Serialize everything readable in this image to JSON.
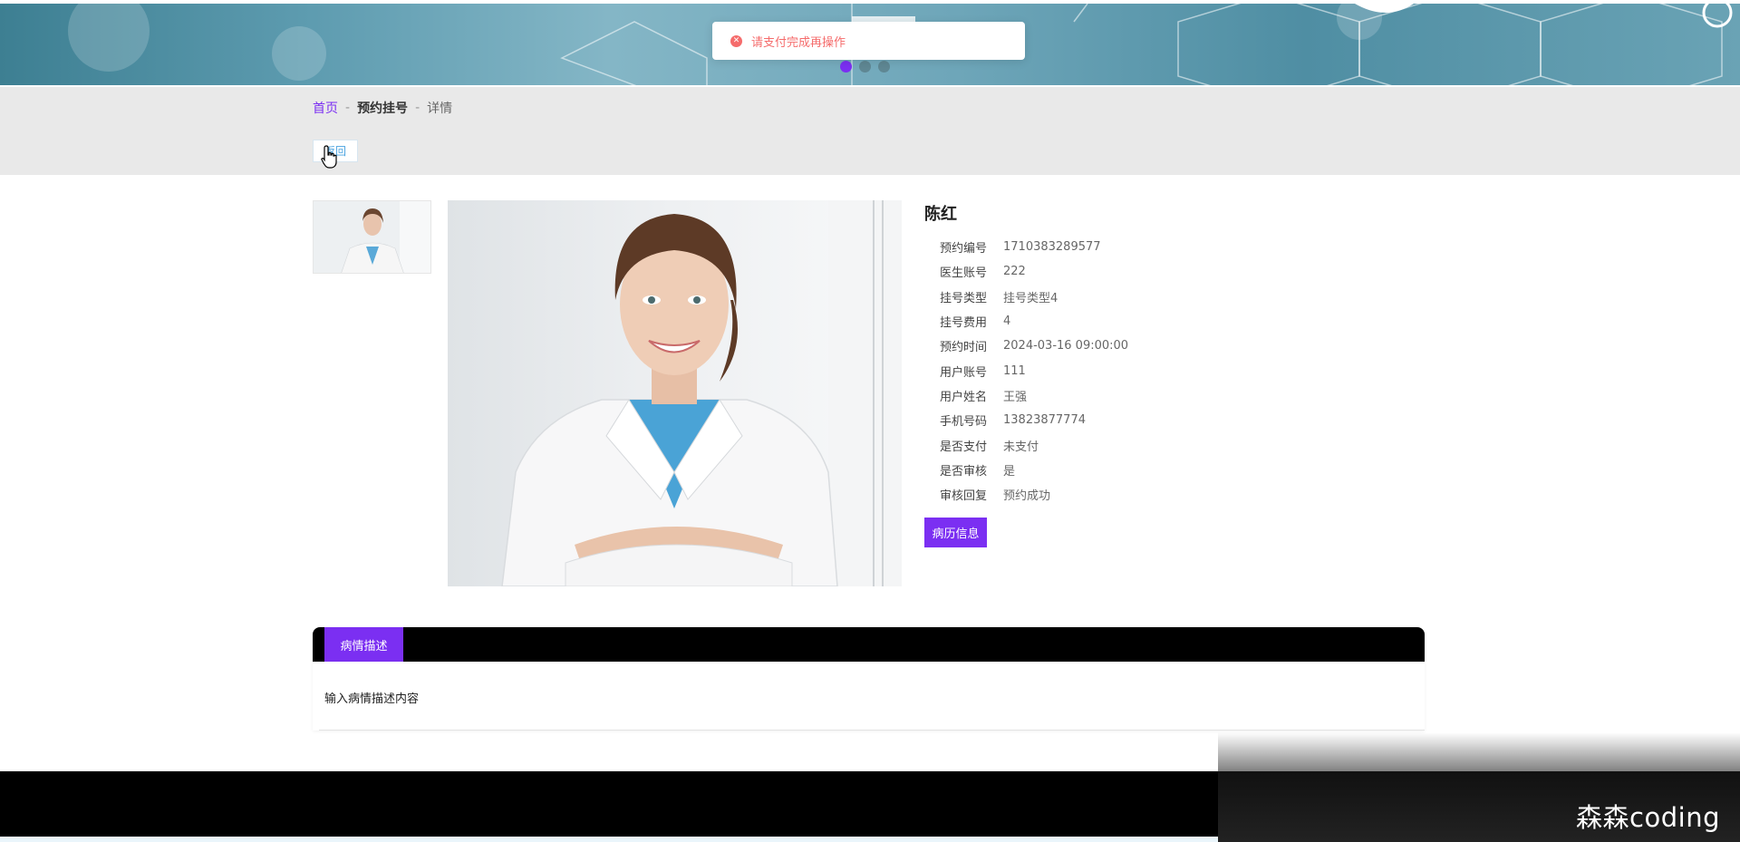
{
  "toast": {
    "message": "请支付完成再操作"
  },
  "breadcrumb": {
    "home": "首页",
    "sep": "-",
    "section": "预约挂号",
    "current": "详情"
  },
  "back_label": "返回",
  "detail": {
    "name": "陈红",
    "fields": [
      {
        "label": "预约编号",
        "value": "1710383289577"
      },
      {
        "label": "医生账号",
        "value": "222"
      },
      {
        "label": "挂号类型",
        "value": "挂号类型4"
      },
      {
        "label": "挂号费用",
        "value": "4"
      },
      {
        "label": "预约时间",
        "value": "2024-03-16 09:00:00"
      },
      {
        "label": "用户账号",
        "value": "111"
      },
      {
        "label": "用户姓名",
        "value": "王强"
      },
      {
        "label": "手机号码",
        "value": "13823877774"
      },
      {
        "label": "是否支付",
        "value": "未支付"
      },
      {
        "label": "是否审核",
        "value": "是"
      },
      {
        "label": "审核回复",
        "value": "预约成功"
      }
    ],
    "record_button": "病历信息"
  },
  "description": {
    "tab": "病情描述",
    "content": "输入病情描述内容"
  },
  "watermark": "森森coding",
  "colors": {
    "accent": "#7b2ff2",
    "error": "#f56c6c",
    "banner": "#5e9cb0"
  }
}
